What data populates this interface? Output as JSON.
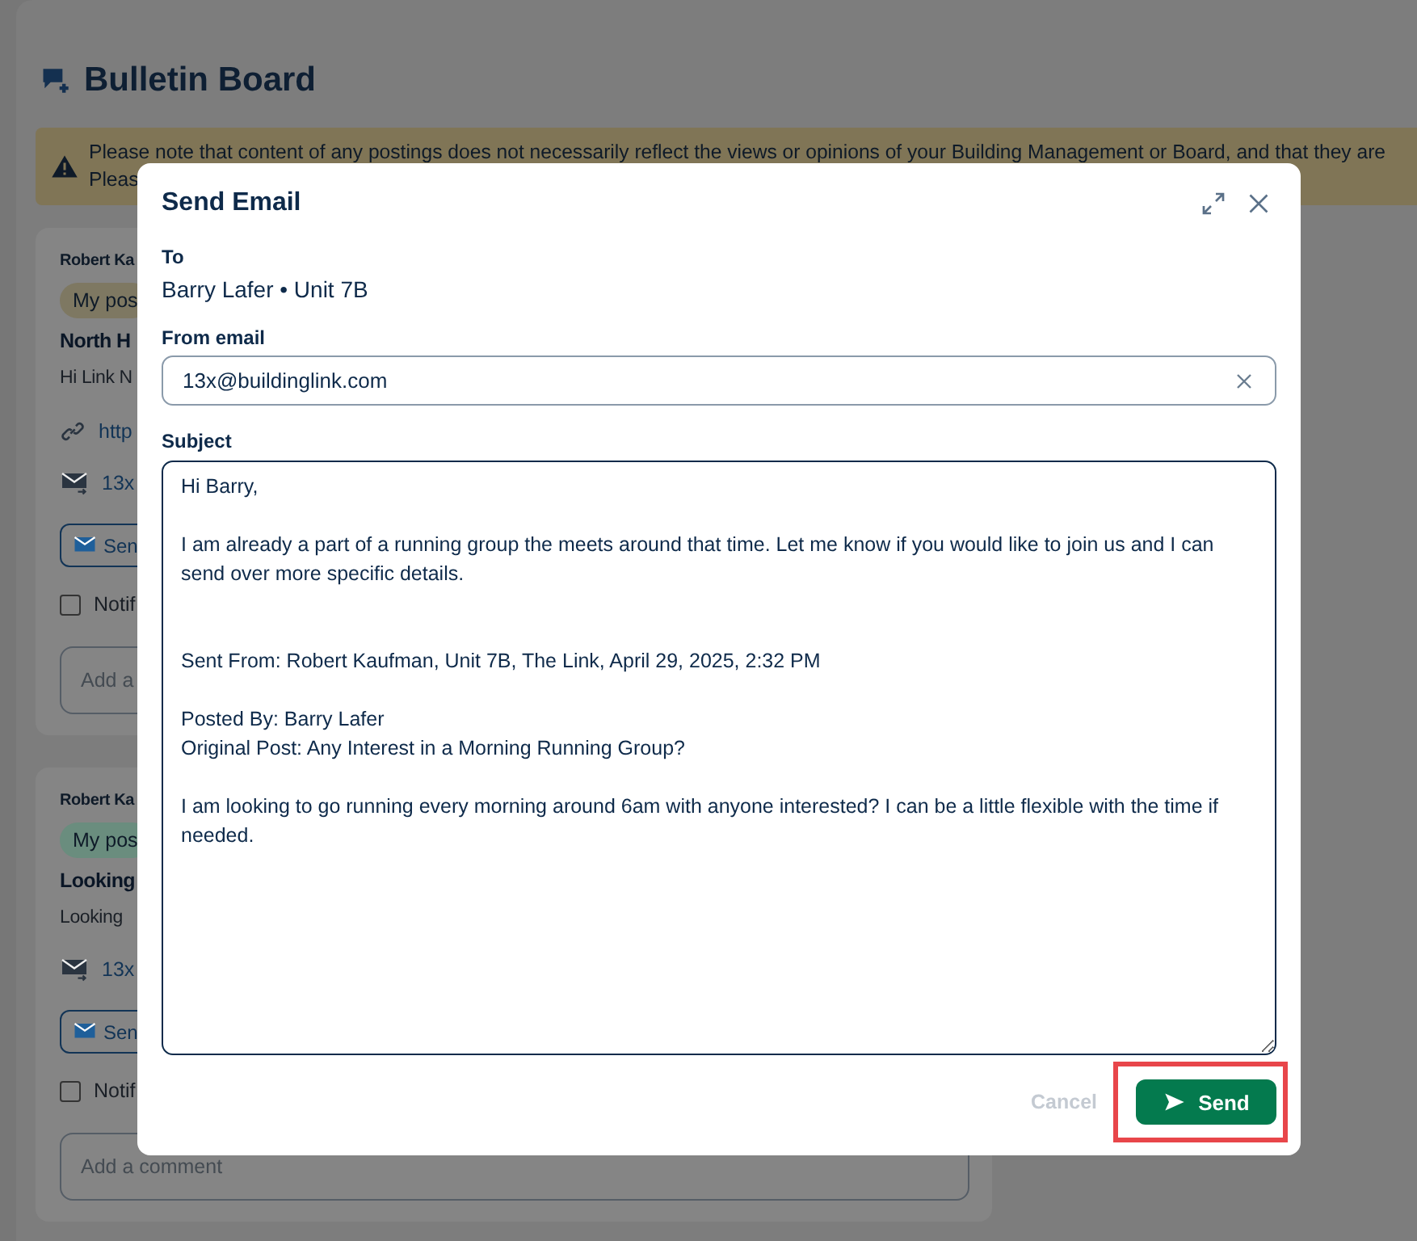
{
  "page": {
    "title": "Bulletin Board",
    "notice": [
      "Please note that content of any postings does not necessarily reflect the views or opinions of your Building Management or Board, and that they are",
      "Pleas"
    ]
  },
  "posts": [
    {
      "author": "Robert Ka",
      "tag": "My pos",
      "color": "#7e7862",
      "title": "North H",
      "body": "Hi Link N",
      "link": "http",
      "email": "13x",
      "button": "Sen",
      "notify": {
        "label": "Notif",
        "checked": false
      },
      "comment_placeholder": "Add a"
    },
    {
      "author": "Robert Ka",
      "tag": "My pos",
      "color": "#6a8d7e",
      "title": "Looking",
      "body": "Looking",
      "email": "13x",
      "button": "Sen",
      "notify": {
        "label": "Notif",
        "checked": false
      },
      "comment_placeholder": "Add a comment"
    }
  ],
  "dialog": {
    "title": "Send Email",
    "to_label": "To",
    "to_value": "Barry Lafer • Unit 7B",
    "from_label": "From email",
    "from_value": "13x@buildinglink.com",
    "subject_label": "Subject",
    "message": "Hi Barry,\n\nI am already a part of a running group the meets around that time. Let me know if you would like to join us and I can send over more specific details.\n\n\nSent From: Robert Kaufman, Unit 7B, The Link, April 29, 2025, 2:32 PM\n\nPosted By: Barry Lafer\nOriginal Post: Any Interest in a Morning Running Group?\n\nI am looking to go running every morning around 6am with anyone interested? I can be a little flexible with the time if needed.",
    "cancel": {
      "label": "Cancel",
      "disabled": true
    },
    "send": {
      "label": "Send",
      "highlighted": true
    }
  }
}
